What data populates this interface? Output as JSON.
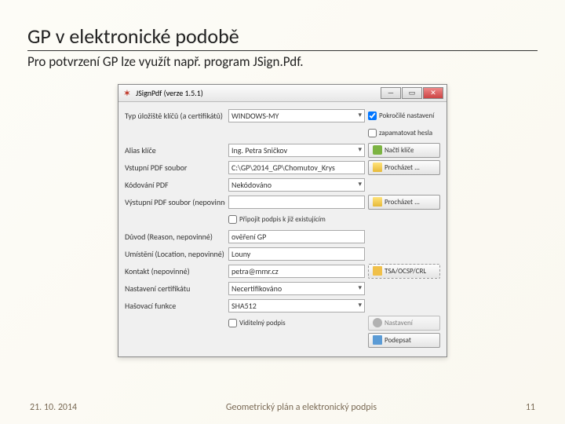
{
  "slide": {
    "title": "GP v elektronické podobě",
    "subtitle": "Pro potvrzení GP lze využít např. program JSign.Pdf."
  },
  "window": {
    "title": "JSignPdf (verze 1.5.1)"
  },
  "form": {
    "keystore_label": "Typ úložiště klíčů (a certifikátů)",
    "keystore_value": "WINDOWS-MY",
    "advanced_label": "Pokročilé nastavení",
    "remember_label": "zapamatovat hesla",
    "alias_label": "Alias klíče",
    "alias_value": "Ing. Petra Sničkov",
    "load_keys_btn": "Načti klíče",
    "input_label": "Vstupní PDF soubor",
    "input_value": "C:\\GP\\2014_GP\\Chomutov_Krys",
    "browse_in_btn": "Procházet ...",
    "encoding_label": "Kódování PDF",
    "encoding_value": "Nekódováno",
    "output_label": "Výstupní PDF soubor (nepovinné)",
    "output_value": "",
    "browse_out_btn": "Procházet ...",
    "append_label": "Připojit podpis k již existujícím",
    "reason_label": "Důvod (Reason, nepovinné)",
    "reason_value": "ověření GP",
    "location_label": "Umístění (Location, nepovinné)",
    "location_value": "Louny",
    "contact_label": "Kontakt (nepovinné)",
    "contact_value": "petra@mmr.cz",
    "tsa_btn": "TSA/OCSP/CRL",
    "cert_label": "Nastavení certifikátu",
    "cert_value": "Necertifikováno",
    "hash_label": "Hašovací funkce",
    "hash_value": "SHA512",
    "visible_label": "Viditelný podpis",
    "settings_btn": "Nastavení",
    "sign_btn": "Podepsat"
  },
  "footer": {
    "date": "21. 10. 2014",
    "caption": "Geometrický plán a elektronický podpis",
    "page": "11"
  }
}
